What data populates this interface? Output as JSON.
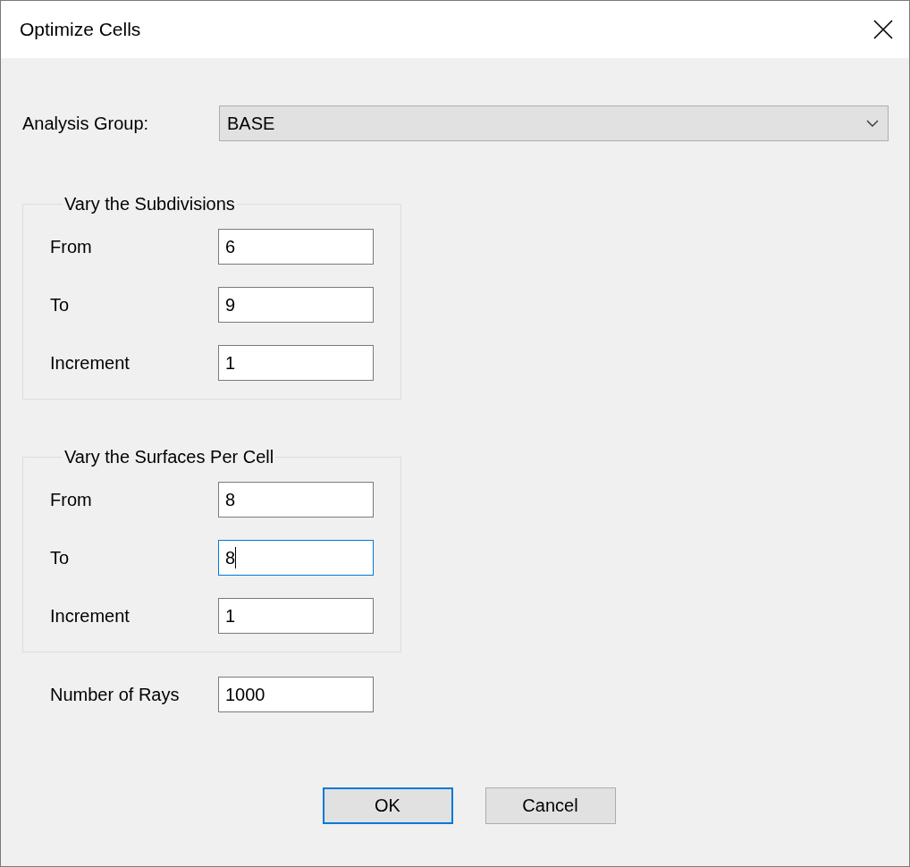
{
  "window": {
    "title": "Optimize Cells"
  },
  "analysis_group": {
    "label": "Analysis Group:",
    "value": "BASE"
  },
  "groups": [
    {
      "title": "Vary the Subdivisions",
      "fields": [
        {
          "label": "From",
          "value": "6",
          "focused": false
        },
        {
          "label": "To",
          "value": "9",
          "focused": false
        },
        {
          "label": "Increment",
          "value": "1",
          "focused": false
        }
      ]
    },
    {
      "title": "Vary the Surfaces Per Cell",
      "fields": [
        {
          "label": "From",
          "value": "8",
          "focused": false
        },
        {
          "label": "To",
          "value": "8",
          "focused": true
        },
        {
          "label": "Increment",
          "value": "1",
          "focused": false
        }
      ]
    }
  ],
  "rays": {
    "label": "Number of Rays",
    "value": "1000",
    "focused": false
  },
  "buttons": [
    {
      "label": "OK",
      "default": true
    },
    {
      "label": "Cancel",
      "default": false
    }
  ]
}
